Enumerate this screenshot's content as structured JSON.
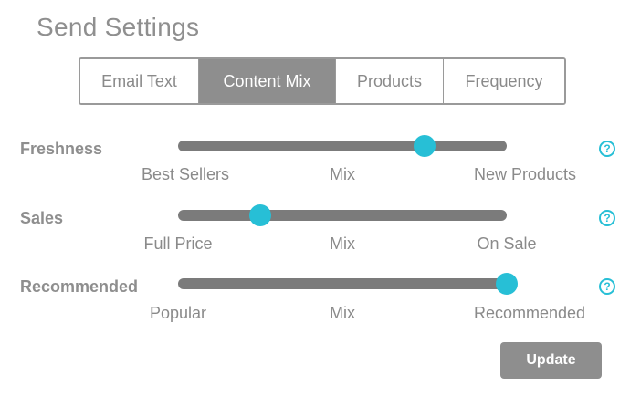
{
  "title": "Send Settings",
  "tabs": [
    {
      "label": "Email Text",
      "active": false
    },
    {
      "label": "Content Mix",
      "active": true
    },
    {
      "label": "Products",
      "active": false
    },
    {
      "label": "Frequency",
      "active": false
    }
  ],
  "sliders": [
    {
      "label": "Freshness",
      "left_label": "Best Sellers",
      "mid_label": "Mix",
      "right_label": "New Products",
      "value": 0.75,
      "help": "?"
    },
    {
      "label": "Sales",
      "left_label": "Full Price",
      "mid_label": "Mix",
      "right_label": "On Sale",
      "value": 0.25,
      "help": "?"
    },
    {
      "label": "Recommended",
      "left_label": "Popular",
      "mid_label": "Mix",
      "right_label": "Recommended",
      "value": 1.0,
      "help": "?"
    }
  ],
  "update_label": "Update",
  "colors": {
    "accent": "#27bfd6",
    "track": "#7b7b7b",
    "active_tab": "#8e8e8e",
    "button": "#8e8e8e"
  }
}
